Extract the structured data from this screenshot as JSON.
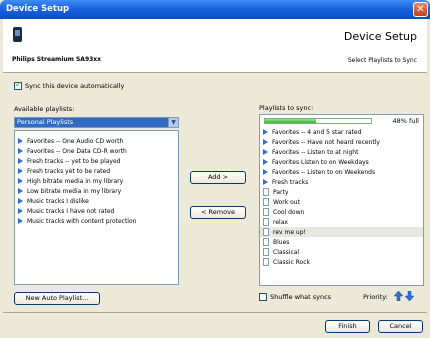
{
  "window": {
    "title": "Device Setup"
  },
  "header": {
    "device_name": "Philips Streamium SA93xx",
    "title": "Device Setup",
    "subtitle": "Select Playlists to Sync"
  },
  "sync_auto": {
    "label": "Sync this device automatically",
    "checked": true
  },
  "available": {
    "label": "Available playlists:",
    "selected_option": "Personal Playlists",
    "items": [
      "Favorites -- One Audio CD worth",
      "Favorites -- One Data CD-R worth",
      "Fresh tracks -- yet to be played",
      "Fresh tracks    yet to be rated",
      "High bitrate media in my library",
      "Low bitrate media in my library",
      "Music tracks I dislike",
      "Music tracks I have not rated",
      "Music tracks with content protection"
    ]
  },
  "buttons": {
    "add": "Add  >",
    "remove": "<  Remove",
    "new_auto": "New Auto Playlist...",
    "finish": "Finish",
    "cancel": "Cancel"
  },
  "to_sync": {
    "label": "Playlists to sync:",
    "progress_label": "48% full",
    "progress_fraction": 0.48,
    "items": [
      {
        "text": "Favorites -- 4 and 5 star rated",
        "icon": "auto-playlist-icon"
      },
      {
        "text": "Favorites -- Have not heard recently",
        "icon": "auto-playlist-icon"
      },
      {
        "text": "Favorites -- Listen to at night",
        "icon": "auto-playlist-icon"
      },
      {
        "text": "Favorites    Listen to on Weekdays",
        "icon": "auto-playlist-icon"
      },
      {
        "text": "Favorites -- Listen to on Weekends",
        "icon": "auto-playlist-icon"
      },
      {
        "text": "Fresh tracks",
        "icon": "auto-playlist-icon"
      },
      {
        "text": "Party",
        "icon": "playlist-icon"
      },
      {
        "text": "Work out",
        "icon": "playlist-icon"
      },
      {
        "text": "Cool down",
        "icon": "playlist-icon"
      },
      {
        "text": "relax",
        "icon": "playlist-icon"
      },
      {
        "text": "rev me up!",
        "icon": "playlist-icon",
        "selected": true
      },
      {
        "text": "Blues",
        "icon": "playlist-icon"
      },
      {
        "text": "Classical",
        "icon": "playlist-icon"
      },
      {
        "text": "Classic Rock",
        "icon": "playlist-icon"
      }
    ]
  },
  "shuffle": {
    "label": "Shuffle what syncs",
    "checked": false
  },
  "priority": {
    "label": "Priority:"
  },
  "colors": {
    "accent": "#316ac5",
    "titlebar": "#0a4ec8",
    "progress": "#2fb82f"
  }
}
